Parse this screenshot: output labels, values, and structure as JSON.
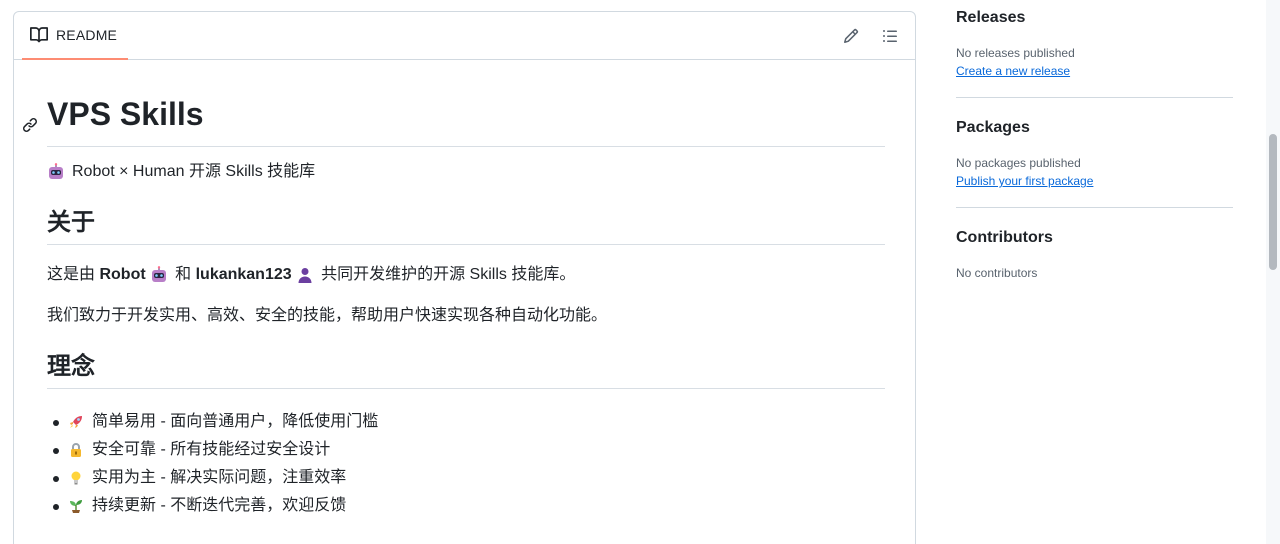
{
  "readme": {
    "tab_label": "README",
    "title": "VPS Skills",
    "tagline": "Robot × Human 开源 Skills 技能库",
    "about_heading": "关于",
    "about_p1_prefix": "这是由",
    "about_p1_robot": "Robot",
    "about_p1_and": "和",
    "about_p1_user": "lukankan123",
    "about_p1_suffix": "共同开发维护的开源 Skills 技能库。",
    "about_p2": "我们致力于开发实用、高效、安全的技能，帮助用户快速实现各种自动化功能。",
    "idea_heading": "理念",
    "principles": [
      {
        "icon": "rocket-icon",
        "text": "简单易用 - 面向普通用户，降低使用门槛"
      },
      {
        "icon": "lock-icon",
        "text": "安全可靠 - 所有技能经过安全设计"
      },
      {
        "icon": "lightbulb-icon",
        "text": "实用为主 - 解决实际问题，注重效率"
      },
      {
        "icon": "seedling-icon",
        "text": "持续更新 - 不断迭代完善，欢迎反馈"
      }
    ]
  },
  "sidebar": {
    "releases": {
      "title": "Releases",
      "status": "No releases published",
      "link": "Create a new release"
    },
    "packages": {
      "title": "Packages",
      "status": "No packages published",
      "link": "Publish your first package"
    },
    "contributors": {
      "title": "Contributors",
      "status": "No contributors"
    }
  },
  "colors": {
    "accent_tab": "#fd8c73",
    "link": "#0969da",
    "border": "#d1d9e0"
  }
}
